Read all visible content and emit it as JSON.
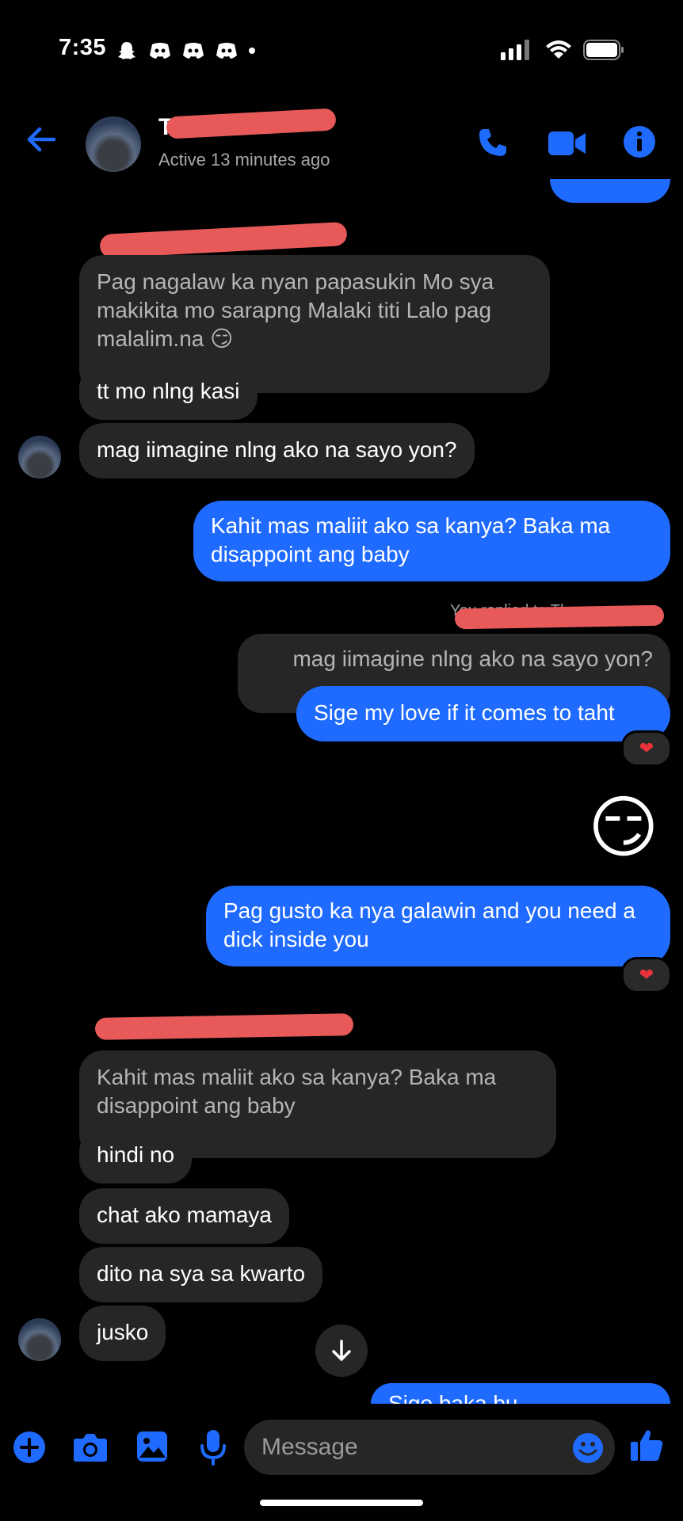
{
  "status_bar": {
    "time": "7:35"
  },
  "header": {
    "contact_name": "Th",
    "active_status": "Active 13 minutes ago"
  },
  "messages": {
    "m1": "Pag nagalaw ka nyan papasukin Mo sya makikita mo sarapng Malaki titi Lalo pag malalim.na 😏",
    "m2": "tt mo nlng kasi",
    "m3": "mag iimagine nlng ako na sayo yon?",
    "m4": "Kahit mas maliit ako sa kanya? Baka ma disappoint ang baby",
    "reply_label": "You replied to Th",
    "m5_quote": "mag iimagine nlng ako na sayo yon?",
    "m5": "Sige my love if it comes to taht",
    "m6_emoji": "😏",
    "m7": "Pag gusto ka nya galawin and you need a dick inside you",
    "m8_quote": "Kahit mas maliit ako sa kanya? Baka ma disappoint ang baby",
    "m9": "hindi no",
    "m10": "chat ako mamaya",
    "m11": "dito na sya sa kwarto",
    "m12": "jusko",
    "m13_partial": "Sige baka bu..."
  },
  "reactions": {
    "heart": "❤"
  },
  "composer": {
    "placeholder": "Message"
  },
  "colors": {
    "accent": "#1f6bff",
    "incoming_bubble": "#262626",
    "redaction": "#e85a5a"
  },
  "icons": [
    "back-arrow-icon",
    "phone-icon",
    "video-camera-icon",
    "info-icon",
    "plus-icon",
    "camera-icon",
    "image-icon",
    "microphone-icon",
    "emoji-icon",
    "thumbs-up-icon",
    "arrow-down-icon"
  ]
}
